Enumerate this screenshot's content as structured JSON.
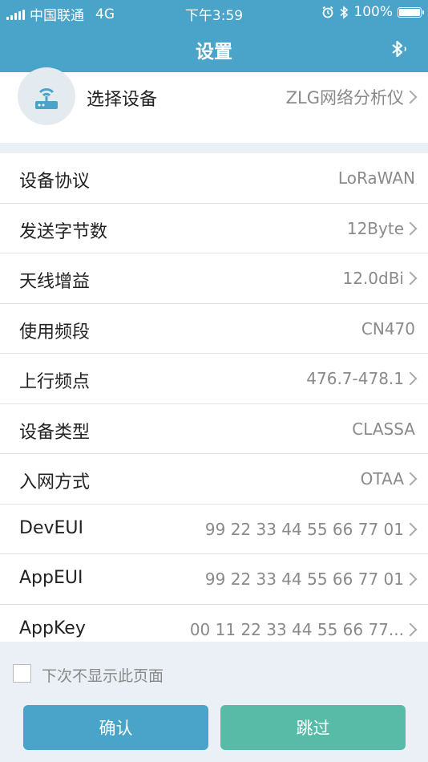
{
  "status_bar": {
    "carrier": "中国联通",
    "network": "4G",
    "time": "下午3:59",
    "battery": "100%",
    "battery_level": 1.0
  },
  "nav": {
    "title": "设置",
    "right_icon": "bluetooth-icon"
  },
  "device": {
    "label": "选择设备",
    "value": "ZLG网络分析仪",
    "icon": "router-icon"
  },
  "settings": [
    {
      "key": "设备协议",
      "value": "LoRaWAN",
      "chevron": false
    },
    {
      "key": "发送字节数",
      "value": "12Byte",
      "chevron": true
    },
    {
      "key": "天线增益",
      "value": "12.0dBi",
      "chevron": true
    },
    {
      "key": "使用频段",
      "value": "CN470",
      "chevron": false
    },
    {
      "key": "上行频点",
      "value": "476.7-478.1",
      "chevron": true
    },
    {
      "key": "设备类型",
      "value": "CLASSA",
      "chevron": false
    },
    {
      "key": "入网方式",
      "value": "OTAA",
      "chevron": true
    },
    {
      "key": "DevEUI",
      "value": "99 22 33 44 55 66 77 01",
      "chevron": true
    },
    {
      "key": "AppEUI",
      "value": "99 22 33 44 55 66 77 01",
      "chevron": true
    },
    {
      "key": "AppKey",
      "value": "00 11 22 33 44 55 66 77...",
      "chevron": true
    }
  ],
  "footer": {
    "checkbox_label": "下次不显示此页面",
    "confirm_label": "确认",
    "skip_label": "跳过"
  },
  "colors": {
    "header": "#4aa3c8",
    "confirm": "#4aa3c8",
    "skip": "#58bba8",
    "background": "#eaf0f5"
  }
}
